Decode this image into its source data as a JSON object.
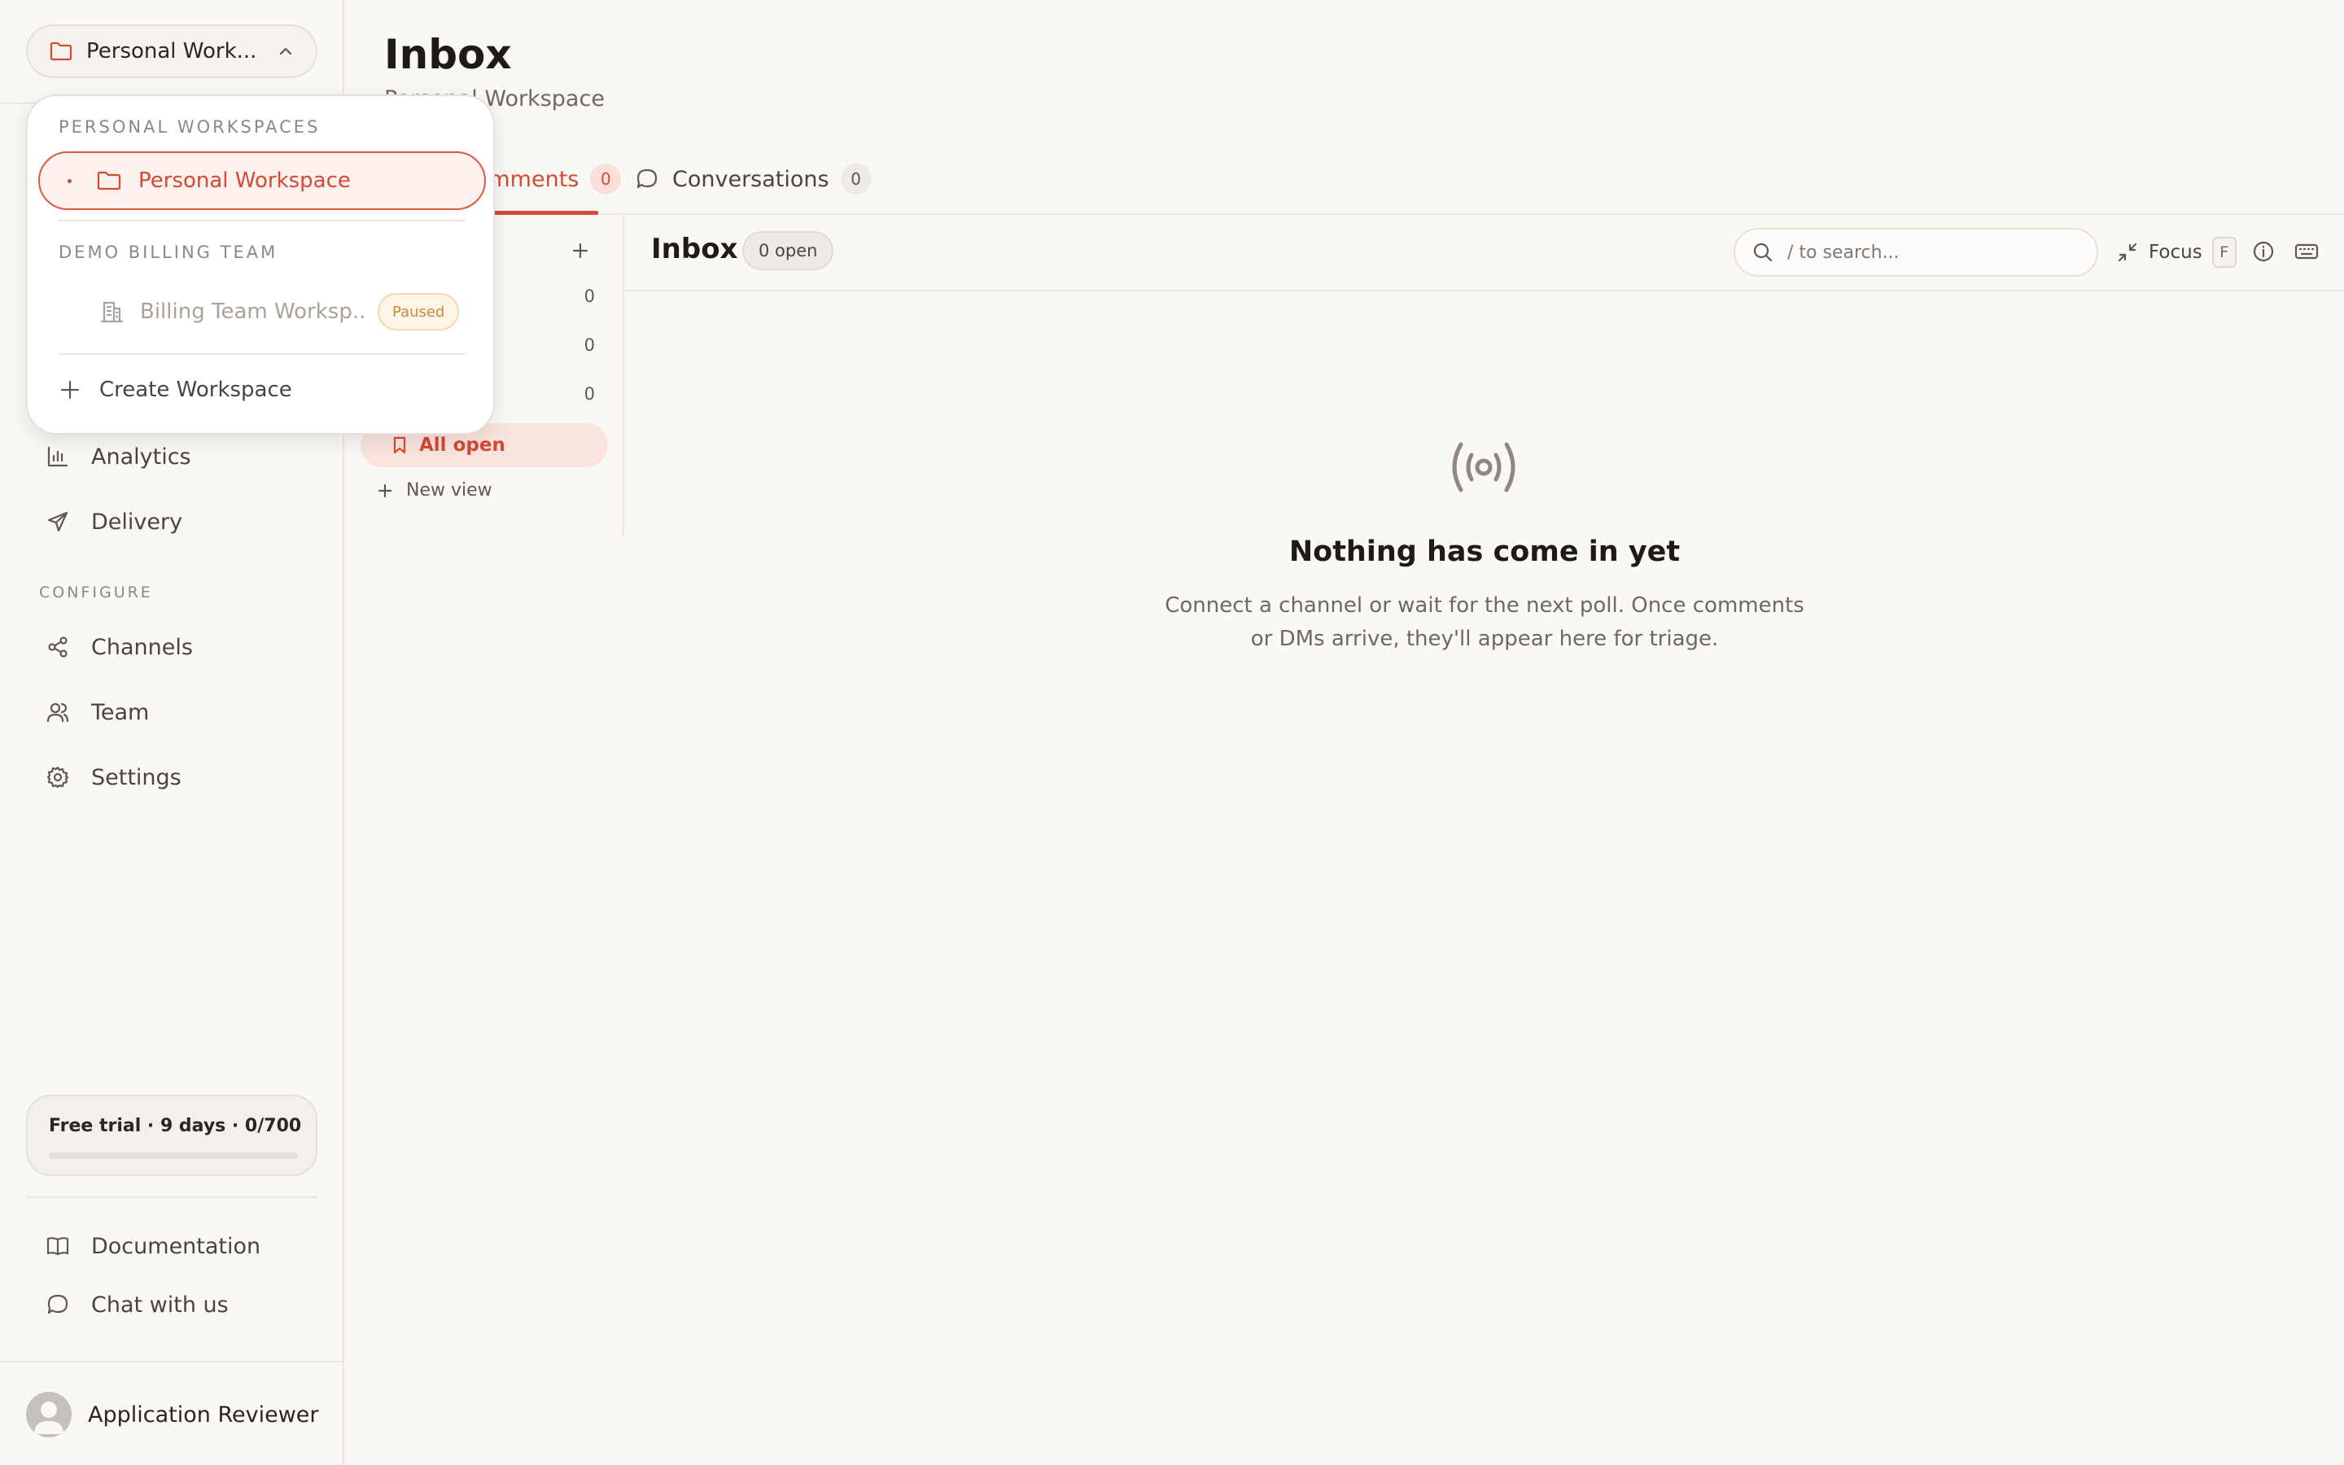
{
  "sidebar": {
    "workspace_switcher": {
      "label": "Personal Work..."
    },
    "nav_main": [
      {
        "label": "Analytics",
        "icon": "bar-chart-icon"
      },
      {
        "label": "Delivery",
        "icon": "send-icon"
      }
    ],
    "configure_label": "CONFIGURE",
    "nav_configure": [
      {
        "label": "Channels",
        "icon": "share-icon"
      },
      {
        "label": "Team",
        "icon": "users-icon"
      },
      {
        "label": "Settings",
        "icon": "gear-icon"
      }
    ],
    "trial": {
      "text": "Free trial · 9 days · 0/700",
      "progress_fraction": 0
    },
    "footer_links": [
      {
        "label": "Documentation",
        "icon": "book-icon"
      },
      {
        "label": "Chat with us",
        "icon": "chat-icon"
      }
    ],
    "user": {
      "name": "Application Reviewer"
    }
  },
  "header": {
    "title": "Inbox",
    "subtitle": "Personal Workspace",
    "tabs": [
      {
        "label": "Comments",
        "count": "0",
        "active": true
      },
      {
        "label": "Conversations",
        "count": "0",
        "active": false
      }
    ]
  },
  "views": {
    "counts": [
      "0",
      "0",
      "0"
    ],
    "all_open": "All open",
    "new_view": "New view"
  },
  "toolbar": {
    "title": "Inbox",
    "open_badge": "0 open",
    "search_placeholder": "/ to search...",
    "focus_label": "Focus",
    "focus_key": "F"
  },
  "empty_state": {
    "title": "Nothing has come in yet",
    "description": "Connect a channel or wait for the next poll. Once comments or DMs arrive, they'll appear here for triage."
  },
  "dropdown": {
    "section_personal": "PERSONAL WORKSPACES",
    "selected_workspace": "Personal Workspace",
    "section_team": "DEMO BILLING TEAM",
    "billing_workspace": "Billing Team Worksp...",
    "billing_status": "Paused",
    "create_label": "Create Workspace"
  },
  "colors": {
    "accent": "#d44a33",
    "background": "#faf8f5",
    "paused": "#c98a3a"
  }
}
